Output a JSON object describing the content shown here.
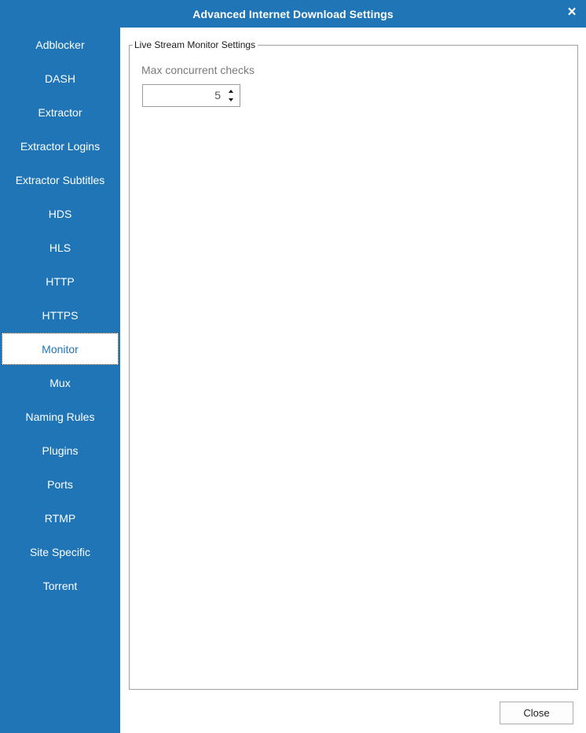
{
  "window": {
    "title": "Advanced Internet Download Settings",
    "close_icon": "×"
  },
  "sidebar": {
    "items": [
      {
        "label": "Adblocker"
      },
      {
        "label": "DASH"
      },
      {
        "label": "Extractor"
      },
      {
        "label": "Extractor Logins"
      },
      {
        "label": "Extractor Subtitles"
      },
      {
        "label": "HDS"
      },
      {
        "label": "HLS"
      },
      {
        "label": "HTTP"
      },
      {
        "label": "HTTPS"
      },
      {
        "label": "Monitor"
      },
      {
        "label": "Mux"
      },
      {
        "label": "Naming Rules"
      },
      {
        "label": "Plugins"
      },
      {
        "label": "Ports"
      },
      {
        "label": "RTMP"
      },
      {
        "label": "Site Specific"
      },
      {
        "label": "Torrent"
      }
    ],
    "active": "Monitor"
  },
  "settings": {
    "group_title": "Live Stream Monitor Settings",
    "max_concurrent_label": "Max concurrent checks",
    "max_concurrent_value": "5"
  },
  "footer": {
    "close_label": "Close"
  },
  "colors": {
    "accent": "#1f75b6"
  }
}
